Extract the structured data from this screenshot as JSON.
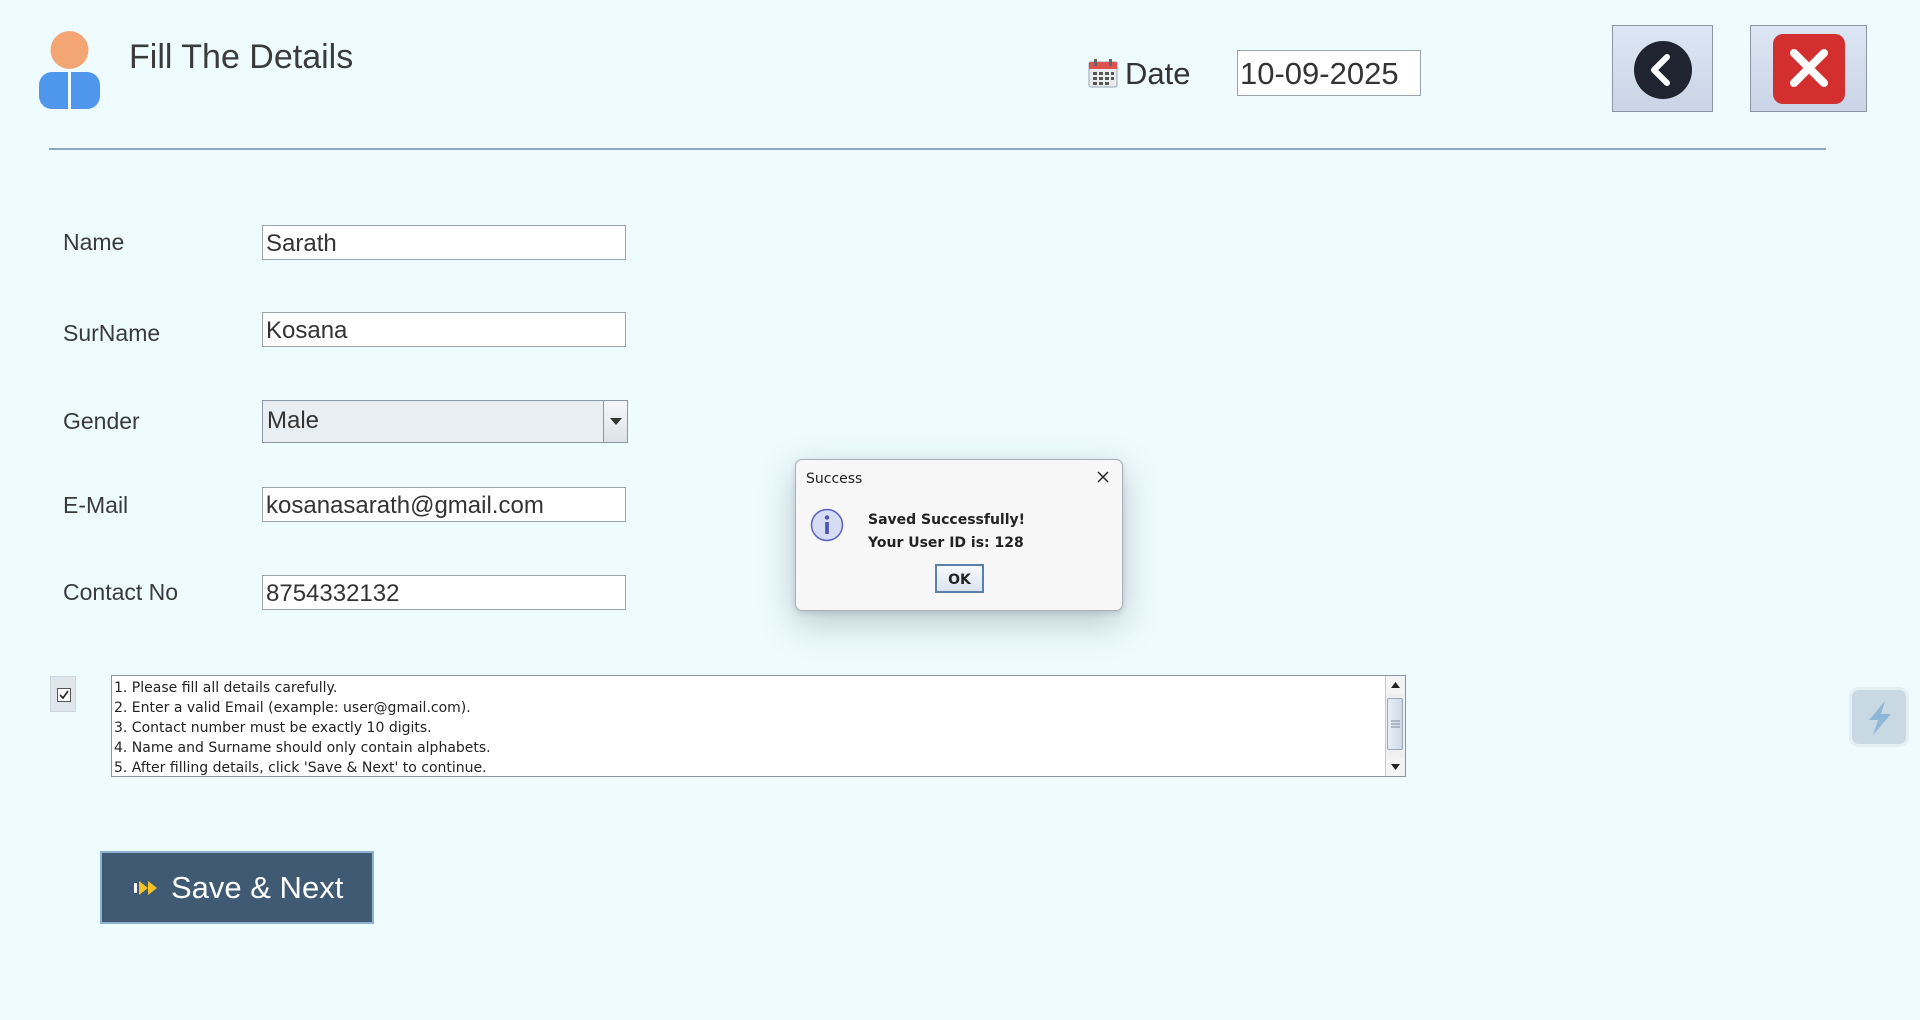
{
  "header": {
    "title": "Fill The Details",
    "date_label": "Date",
    "date_value": "10-09-2025",
    "icons": [
      "user-avatar-icon",
      "calendar-icon",
      "back-arrow-icon",
      "close-x-icon"
    ]
  },
  "form": {
    "name_label": "Name",
    "name_value": "Sarath",
    "surname_label": "SurName",
    "surname_value": "Kosana",
    "gender_label": "Gender",
    "gender_value": "Male",
    "email_label": "E-Mail",
    "email_value": "kosanasarath@gmail.com",
    "contact_label": "Contact No",
    "contact_value": "8754332132"
  },
  "terms_checked": true,
  "notes": [
    "1. Please fill all details carefully.",
    "2. Enter a valid Email (example: user@gmail.com).",
    "3. Contact number must be exactly 10 digits.",
    "4. Name and Surname should only contain alphabets.",
    "5. After filling details, click 'Save & Next' to continue."
  ],
  "save_button_label": "Save & Next",
  "dialog": {
    "title": "Success",
    "message_line1": "Saved Successfully!",
    "message_line2": "Your User ID is: 128",
    "ok_label": "OK"
  },
  "colors": {
    "background": "#eefcff",
    "save_button": "#3f5a72",
    "close_button": "#d32f2f",
    "back_button_circle": "#1f2430",
    "avatar_head": "#f4a574",
    "avatar_body": "#4f97ec"
  }
}
